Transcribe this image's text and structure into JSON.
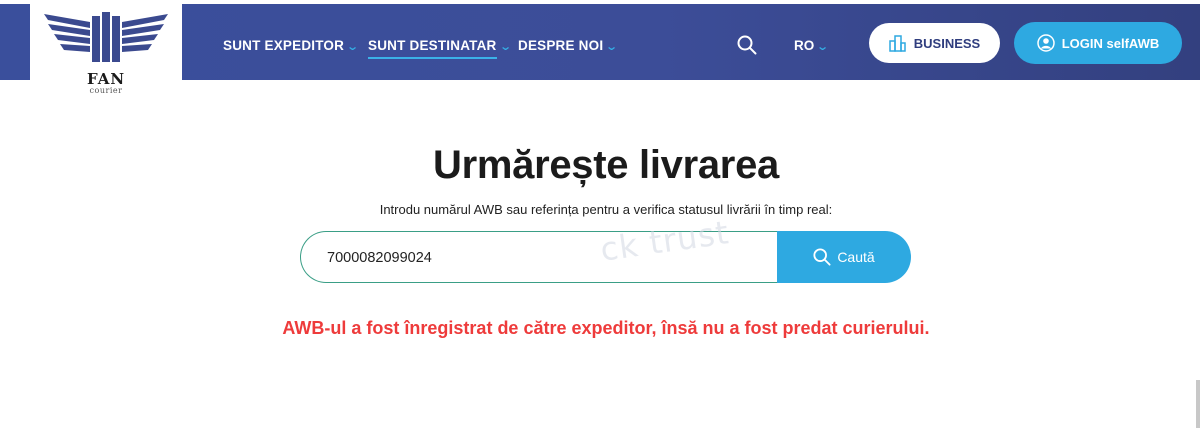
{
  "brand": {
    "name": "FAN",
    "sub": "courier"
  },
  "nav": [
    {
      "label": "SUNT EXPEDITOR",
      "has_dropdown": true,
      "active": false
    },
    {
      "label": "SUNT DESTINATAR",
      "has_dropdown": true,
      "active": true
    },
    {
      "label": "DESPRE NOI",
      "has_dropdown": true,
      "active": false
    }
  ],
  "header": {
    "language": "RO",
    "business_label": "BUSINESS",
    "login_label": "LOGIN selfAWB",
    "search_icon": "search-icon",
    "colors": {
      "header_bg": "#3a4f9c",
      "accent": "#2ea9e1"
    }
  },
  "tracking": {
    "title": "Urmărește livrarea",
    "subtitle": "Introdu numărul AWB sau referința pentru a verifica statusul livrării în timp real:",
    "awb_value": "7000082099024",
    "search_button": "Caută",
    "watermark": "ck trust",
    "error": "AWB-ul a fost înregistrat de către expeditor, însă nu a fost predat curierului.",
    "colors": {
      "error": "#ee3b3b",
      "input_border": "#3a9e86"
    }
  }
}
